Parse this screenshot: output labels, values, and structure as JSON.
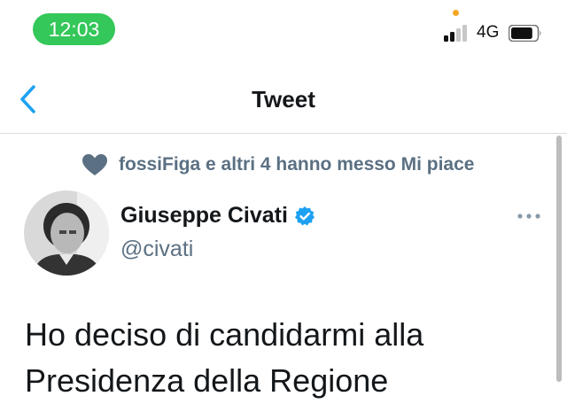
{
  "status_bar": {
    "time": "12:03",
    "network": "4G",
    "signal_bars_filled": 2,
    "signal_bars_total": 4,
    "battery_level": 0.85,
    "colors": {
      "time_pill": "#34c759",
      "privacy_dot": "#f5a623"
    }
  },
  "nav": {
    "title": "Tweet",
    "back_icon": "chevron-left-icon"
  },
  "tweet": {
    "social_context": "fossiFiga e altri 4 hanno messo Mi piace",
    "author_name": "Giuseppe Civati",
    "author_handle": "@civati",
    "verified": true,
    "text": "Ho deciso di candidarmi alla\nPresidenza della Regione"
  },
  "colors": {
    "accent": "#1da1f2",
    "secondary_text": "#5b7083",
    "primary_text": "#14171a"
  }
}
